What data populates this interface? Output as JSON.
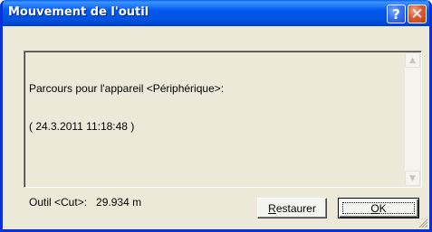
{
  "window": {
    "title": "Mouvement de l'outil",
    "help_glyph": "?",
    "close_glyph": "✕"
  },
  "content": {
    "line1": "Parcours pour l'appareil <Périphérique>:",
    "line2": "( 24.3.2011 11:18:48 )",
    "line3": "Outil <Cut>:   29.934 m"
  },
  "scrollbar": {
    "up_glyph": "▲",
    "down_glyph": "▼"
  },
  "buttons": {
    "restaurer_first": "R",
    "restaurer_rest": "estaurer",
    "ok_first": "O",
    "ok_rest": "K"
  },
  "colors": {
    "titlebar": "#0054e3",
    "face": "#ece9d8",
    "close": "#e0582d",
    "help": "#3b74ef"
  }
}
